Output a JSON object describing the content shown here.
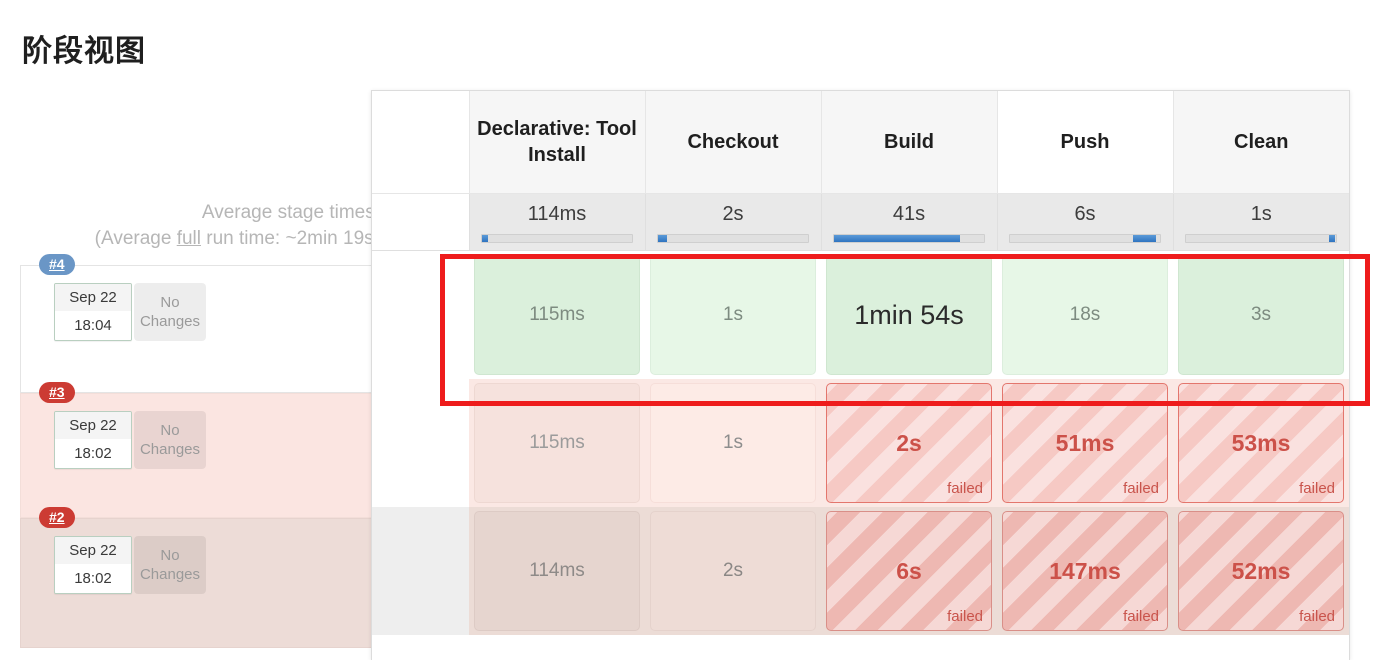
{
  "page": {
    "title": "阶段视图"
  },
  "averages": {
    "line1": "Average stage times:",
    "line2_prefix": "(Average ",
    "line2_underlined": "full",
    "line2_suffix": " run time: ~2min 19s)"
  },
  "stages": [
    {
      "name": "Declarative: Tool Install",
      "avg": "114ms",
      "bar_start_pct": 0,
      "bar_width_pct": 4,
      "hovered": false
    },
    {
      "name": "Checkout",
      "avg": "2s",
      "bar_start_pct": 0,
      "bar_width_pct": 6,
      "hovered": false
    },
    {
      "name": "Build",
      "avg": "41s",
      "bar_start_pct": 0,
      "bar_width_pct": 84,
      "hovered": false
    },
    {
      "name": "Push",
      "avg": "6s",
      "bar_start_pct": 82,
      "bar_width_pct": 15,
      "hovered": true
    },
    {
      "name": "Clean",
      "avg": "1s",
      "bar_start_pct": 95,
      "bar_width_pct": 4,
      "hovered": false
    }
  ],
  "runs": [
    {
      "id": "#4",
      "badge_color": "#6a96c6",
      "status": "ok",
      "date": "Sep 22",
      "time": "18:04",
      "changes": "No Changes",
      "cells": [
        {
          "duration": "115ms",
          "state": "success",
          "shade": "dark",
          "emphasis": false,
          "failed_label": ""
        },
        {
          "duration": "1s",
          "state": "success",
          "shade": "light",
          "emphasis": false,
          "failed_label": ""
        },
        {
          "duration": "1min 54s",
          "state": "success",
          "shade": "dark",
          "emphasis": true,
          "failed_label": ""
        },
        {
          "duration": "18s",
          "state": "success",
          "shade": "light",
          "emphasis": false,
          "failed_label": ""
        },
        {
          "duration": "3s",
          "state": "success",
          "shade": "dark",
          "emphasis": false,
          "failed_label": ""
        }
      ]
    },
    {
      "id": "#3",
      "badge_color": "#cc3b33",
      "status": "failed",
      "date": "Sep 22",
      "time": "18:02",
      "changes": "No Changes",
      "cells": [
        {
          "duration": "115ms",
          "state": "neutral",
          "shade": "a",
          "emphasis": false,
          "failed_label": ""
        },
        {
          "duration": "1s",
          "state": "neutral",
          "shade": "b",
          "emphasis": false,
          "failed_label": ""
        },
        {
          "duration": "2s",
          "state": "failed",
          "shade": "normal",
          "emphasis": false,
          "failed_label": "failed"
        },
        {
          "duration": "51ms",
          "state": "failed",
          "shade": "normal",
          "emphasis": false,
          "failed_label": "failed"
        },
        {
          "duration": "53ms",
          "state": "failed",
          "shade": "normal",
          "emphasis": false,
          "failed_label": "failed"
        }
      ]
    },
    {
      "id": "#2",
      "badge_color": "#cc3b33",
      "status": "failed",
      "date": "Sep 22",
      "time": "18:02",
      "changes": "No Changes",
      "cells": [
        {
          "duration": "114ms",
          "state": "neutral",
          "shade": "c",
          "emphasis": false,
          "failed_label": ""
        },
        {
          "duration": "2s",
          "state": "neutral",
          "shade": "d",
          "emphasis": false,
          "failed_label": ""
        },
        {
          "duration": "6s",
          "state": "failed",
          "shade": "deep",
          "emphasis": false,
          "failed_label": "failed"
        },
        {
          "duration": "147ms",
          "state": "failed",
          "shade": "deep",
          "emphasis": false,
          "failed_label": "failed"
        },
        {
          "duration": "52ms",
          "state": "failed",
          "shade": "deep",
          "emphasis": false,
          "failed_label": "failed"
        }
      ]
    }
  ],
  "annotation": {
    "color": "#ee1c1c",
    "target_run": "#4"
  }
}
